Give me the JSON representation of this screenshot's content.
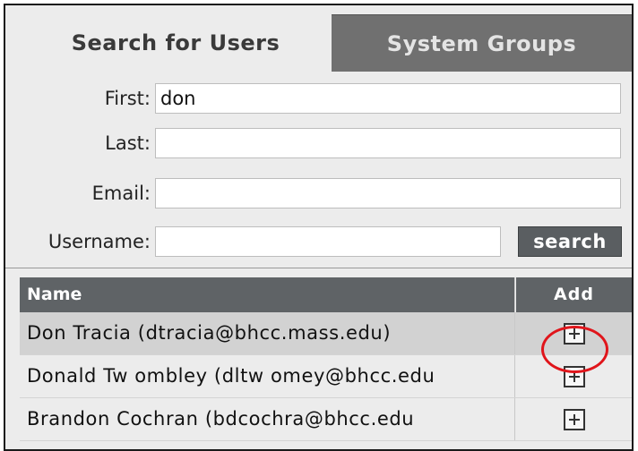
{
  "tabs": [
    {
      "label": "Search for Users",
      "active": true
    },
    {
      "label": "System Groups",
      "active": false
    }
  ],
  "form": {
    "first": {
      "label": "First:",
      "value": "don"
    },
    "last": {
      "label": "Last:",
      "value": ""
    },
    "email": {
      "label": "Email:",
      "value": ""
    },
    "username": {
      "label": "Username:",
      "value": ""
    },
    "search_label": "search"
  },
  "results": {
    "columns": [
      "Name",
      "Add"
    ],
    "rows": [
      {
        "name": "Don Tracia (dtracia@bhcc.mass.edu)",
        "selected": true
      },
      {
        "name": "Donald Tw ombley (dltw omey@bhcc.edu",
        "selected": false
      },
      {
        "name": "Brandon Cochran (bdcochra@bhcc.edu",
        "selected": false
      }
    ]
  },
  "colors": {
    "accent_header": "#5f6366",
    "inactive_tab": "#707070",
    "highlight_ring": "#e0151b",
    "selected_row": "#d2d2d2"
  },
  "icons": {
    "add": "plus-box-icon"
  }
}
